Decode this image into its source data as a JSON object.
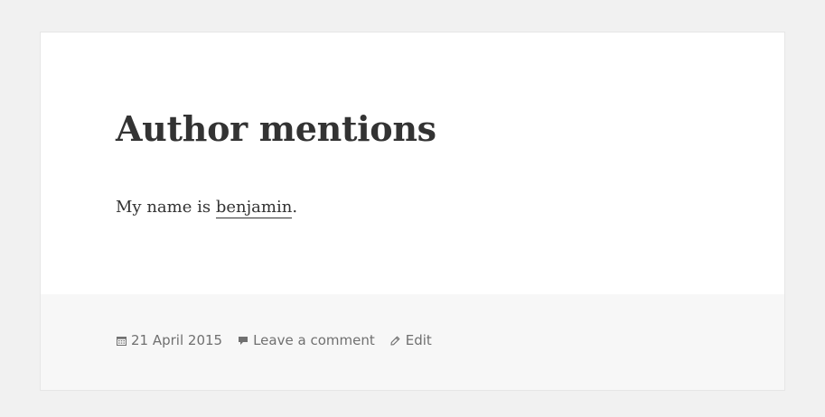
{
  "post": {
    "title": "Author mentions",
    "content_prefix": "My name is ",
    "mention": "benjamin",
    "content_suffix": "."
  },
  "footer": {
    "date": "21 April 2015",
    "comment_link": "Leave a comment",
    "edit_link": "Edit",
    "icons": [
      "calendar-icon",
      "comment-icon",
      "pencil-icon"
    ]
  },
  "colors": {
    "page_background": "#f1f1f1",
    "card_background": "#ffffff",
    "footer_background": "#f7f7f7",
    "text": "#333333",
    "meta_text": "#707070"
  }
}
